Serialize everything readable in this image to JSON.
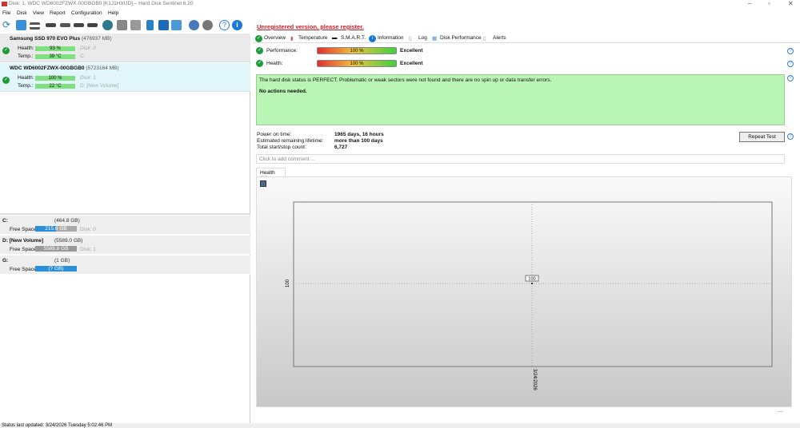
{
  "window": {
    "title": "Disk: 1, WDC WD6002FZWX-00GBGB0 [K1J1HXUD]  –  Hard Disk Sentinel 6.20"
  },
  "menu": [
    "File",
    "Disk",
    "View",
    "Report",
    "Configuration",
    "Help"
  ],
  "disks": [
    {
      "name": "Samsung SSD 970 EVO Plus",
      "size": "(476937 MB)",
      "health_label": "Health:",
      "health": "93 %",
      "health_pct": 93,
      "temp_label": "Temp.:",
      "temp": "39 °C",
      "disk": "Disk: 0",
      "drive": "C:"
    },
    {
      "name": "WDC WD6002FZWX-00GBGB0",
      "size": "(5723164 MB)",
      "health_label": "Health:",
      "health": "100 %",
      "health_pct": 100,
      "temp_label": "Temp.:",
      "temp": "22 °C",
      "disk": "Disk: 1",
      "drive": "D: [New Volume]"
    }
  ],
  "volumes": [
    {
      "name": "C:",
      "size": "(464.8 GB)",
      "free_label": "Free Space",
      "free": "215.6 GB",
      "disk": "Disk: 0",
      "color": "#2a8fd8"
    },
    {
      "name": "D: [New Volume]",
      "size": "(5589.0 GB)",
      "free_label": "Free Space",
      "free": "5588.8 GB",
      "disk": "Disk: 1",
      "color": "#999999"
    },
    {
      "name": "G:",
      "size": "(1 GB)",
      "free_label": "Free Space",
      "free": "(? GB)",
      "disk": "",
      "color": "#2a8fd8"
    }
  ],
  "register": "Unregistered version, please register.",
  "tabs": [
    "Overview",
    "Temperature",
    "S.M.A.R.T.",
    "Information",
    "Log",
    "Disk Performance",
    "Alerts"
  ],
  "performance": {
    "label": "Performance:",
    "value": "100 %",
    "rating": "Excellent"
  },
  "health": {
    "label": "Health:",
    "value": "100 %",
    "rating": "Excellent"
  },
  "message": {
    "line1": "The hard disk status is PERFECT. Problematic or weak sectors were not found and there are no spin up or data transfer errors.",
    "line2": "No actions needed."
  },
  "info": [
    {
      "label": "Power on time:",
      "value": "1965 days, 16 hours"
    },
    {
      "label": "Estimated remaining lifetime:",
      "value": "more than 100 days"
    },
    {
      "label": "Total start/stop count:",
      "value": "6,727"
    }
  ],
  "repeat_test": "Repeat Test",
  "comment_placeholder": "Click to add comment ...",
  "chart_tab": "Health (%)",
  "chart_data": {
    "type": "line",
    "x": [
      "3/24/2026"
    ],
    "values": [
      100
    ],
    "data_labels": [
      "100"
    ],
    "ytick": "100",
    "xtick": "3/24/2026",
    "grid": true
  },
  "status": "Status last updated: 3/24/2026 Tuesday 5:02:46 PM"
}
